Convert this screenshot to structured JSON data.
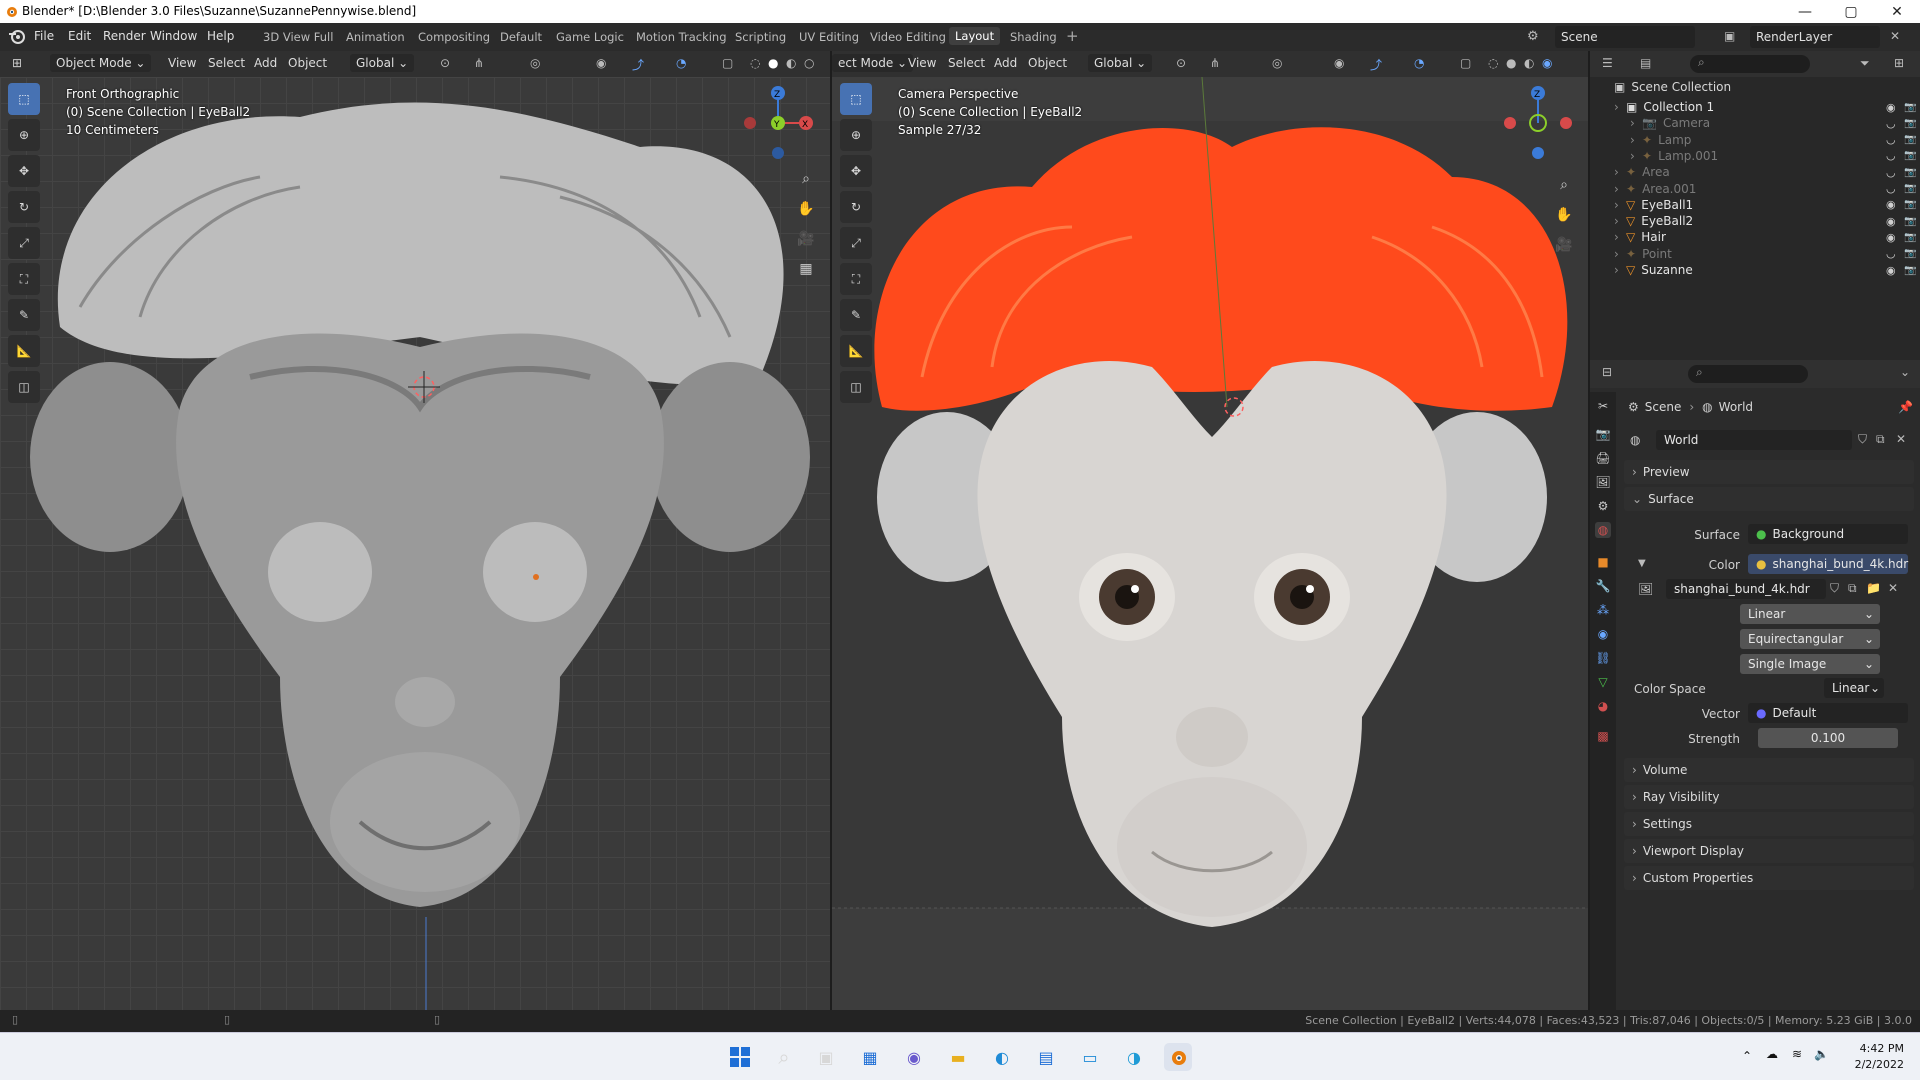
{
  "window": {
    "title": "Blender* [D:\\Blender 3.0 Files\\Suzanne\\SuzannePennywise.blend]",
    "min": "—",
    "max": "▢",
    "close": "✕"
  },
  "menu": [
    "File",
    "Edit",
    "Render",
    "Window",
    "Help"
  ],
  "workspaces": [
    "3D View Full",
    "Animation",
    "Compositing",
    "Default",
    "Game Logic",
    "Motion Tracking",
    "Scripting",
    "UV Editing",
    "Video Editing",
    "Layout",
    "Shading"
  ],
  "active_workspace": "Layout",
  "scene": {
    "label": "Scene",
    "render_layer": "RenderLayer"
  },
  "left_viewport": {
    "mode": "Object Mode",
    "menus": [
      "View",
      "Select",
      "Add",
      "Object"
    ],
    "orientation": "Global",
    "overlay_lines": [
      "Front Orthographic",
      "(0) Scene Collection | EyeBall2",
      "10 Centimeters"
    ]
  },
  "right_viewport": {
    "mode": "ect Mode",
    "menus": [
      "View",
      "Select",
      "Add",
      "Object"
    ],
    "orientation": "Global",
    "overlay_lines": [
      "Camera Perspective",
      "(0) Scene Collection | EyeBall2",
      "Sample 27/32"
    ]
  },
  "outliner": {
    "root": "Scene Collection",
    "items": [
      {
        "name": "Collection 1",
        "level": 1,
        "dim": false
      },
      {
        "name": "Camera",
        "level": 2,
        "dim": true
      },
      {
        "name": "Lamp",
        "level": 2,
        "dim": true
      },
      {
        "name": "Lamp.001",
        "level": 2,
        "dim": true
      },
      {
        "name": "Area",
        "level": 1,
        "dim": true
      },
      {
        "name": "Area.001",
        "level": 1,
        "dim": true
      },
      {
        "name": "EyeBall1",
        "level": 1,
        "dim": false
      },
      {
        "name": "EyeBall2",
        "level": 1,
        "dim": false
      },
      {
        "name": "Hair",
        "level": 1,
        "dim": false
      },
      {
        "name": "Point",
        "level": 1,
        "dim": true
      },
      {
        "name": "Suzanne",
        "level": 1,
        "dim": false
      }
    ]
  },
  "properties": {
    "breadcrumb": [
      "Scene",
      "World"
    ],
    "world_name": "World",
    "panels_top": [
      "Preview",
      "Surface"
    ],
    "surface_label": "Surface",
    "surface_value": "Background",
    "color_label": "Color",
    "color_value": "shanghai_bund_4k.hdr",
    "image_name": "shanghai_bund_4k.hdr",
    "interpolation": "Linear",
    "projection": "Equirectangular",
    "source": "Single Image",
    "color_space_label": "Color Space",
    "color_space": "Linear",
    "vector_label": "Vector",
    "vector_value": "Default",
    "strength_label": "Strength",
    "strength_value": "0.100",
    "panels_bottom": [
      "Volume",
      "Ray Visibility",
      "Settings",
      "Viewport Display",
      "Custom Properties"
    ]
  },
  "status": "Scene Collection | EyeBall2 | Verts:44,078 | Faces:43,523 | Tris:87,046 | Objects:0/5 | Memory: 5.23 GiB | 3.0.0",
  "clock": {
    "time": "4:42 PM",
    "date": "2/2/2022"
  },
  "colors": {
    "accent": "#4772b3",
    "hair": "#ff4a1c",
    "panel": "#2b2b2b",
    "viewport": "#3d3d3d"
  }
}
